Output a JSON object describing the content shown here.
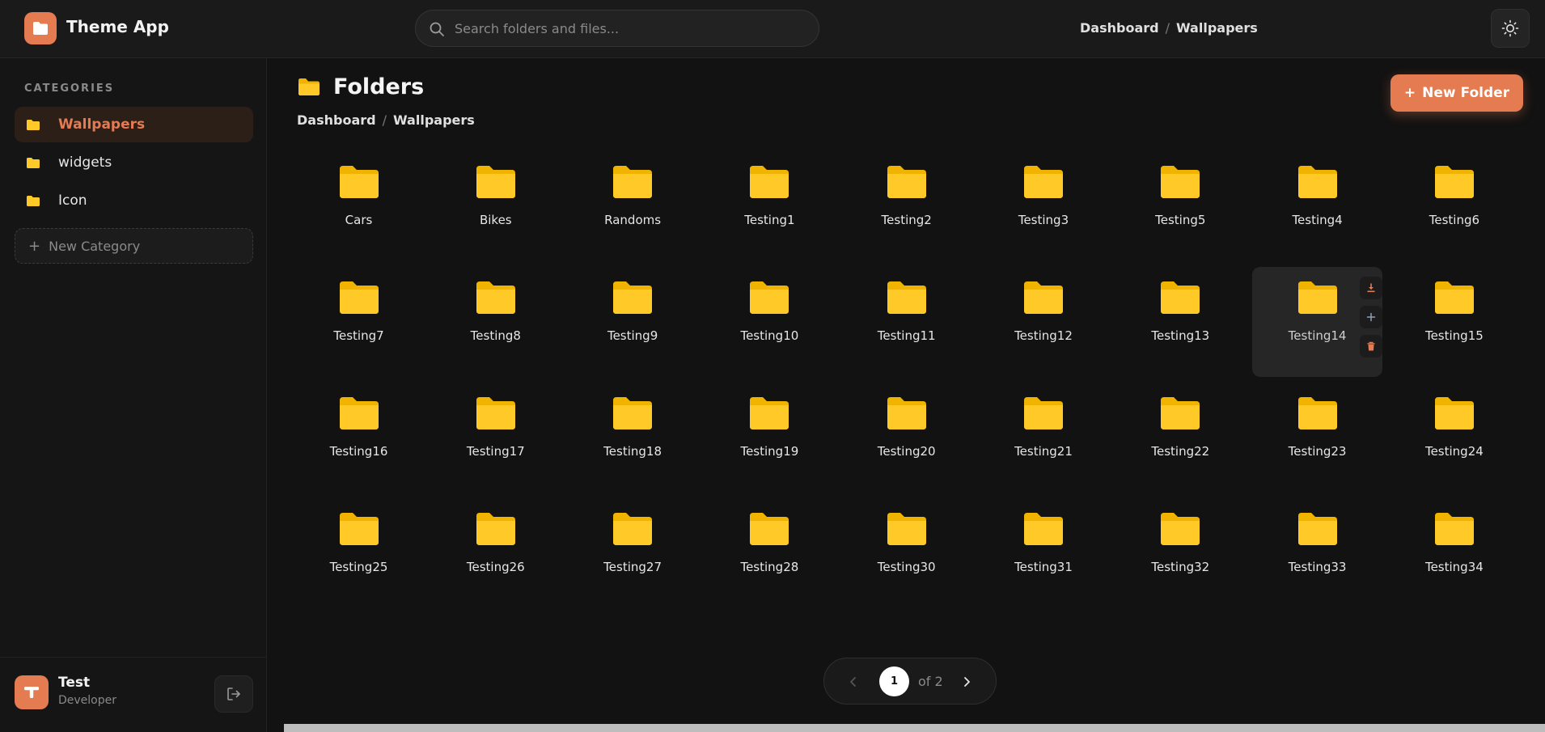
{
  "app": {
    "title": "Theme App"
  },
  "search": {
    "placeholder": "Search folders and files..."
  },
  "header": {
    "breadcrumb": [
      "Dashboard",
      "Wallpapers"
    ],
    "separator": "/"
  },
  "sidebar": {
    "heading": "CATEGORIES",
    "items": [
      {
        "label": "Wallpapers",
        "active": true
      },
      {
        "label": "widgets",
        "active": false
      },
      {
        "label": "Icon",
        "active": false
      }
    ],
    "new_category_label": "New Category"
  },
  "user": {
    "initial": "T",
    "name": "Test",
    "role": "Developer"
  },
  "main": {
    "title": "Folders",
    "breadcrumb": [
      "Dashboard",
      "Wallpapers"
    ],
    "new_folder_label": "New Folder",
    "folders": [
      "Cars",
      "Bikes",
      "Randoms",
      "Testing1",
      "Testing2",
      "Testing3",
      "Testing5",
      "Testing4",
      "Testing6",
      "Testing7",
      "Testing8",
      "Testing9",
      "Testing10",
      "Testing11",
      "Testing12",
      "Testing13",
      "Testing14",
      "Testing15",
      "Testing16",
      "Testing17",
      "Testing18",
      "Testing19",
      "Testing20",
      "Testing21",
      "Testing22",
      "Testing23",
      "Testing24",
      "Testing25",
      "Testing26",
      "Testing27",
      "Testing28",
      "Testing30",
      "Testing31",
      "Testing32",
      "Testing33",
      "Testing34"
    ],
    "hovered_folder": "Testing14"
  },
  "pagination": {
    "current": "1",
    "of_label": "of 2"
  },
  "colors": {
    "accent": "#e57b51",
    "folder": "#ffca28",
    "folder_tab": "#f0b400",
    "background": "#121212"
  },
  "icons": {
    "logo": "folder-icon",
    "search": "search-icon",
    "theme": "sun-icon",
    "logout": "logout-icon",
    "download": "download-icon",
    "add": "plus-icon",
    "delete": "trash-icon"
  }
}
